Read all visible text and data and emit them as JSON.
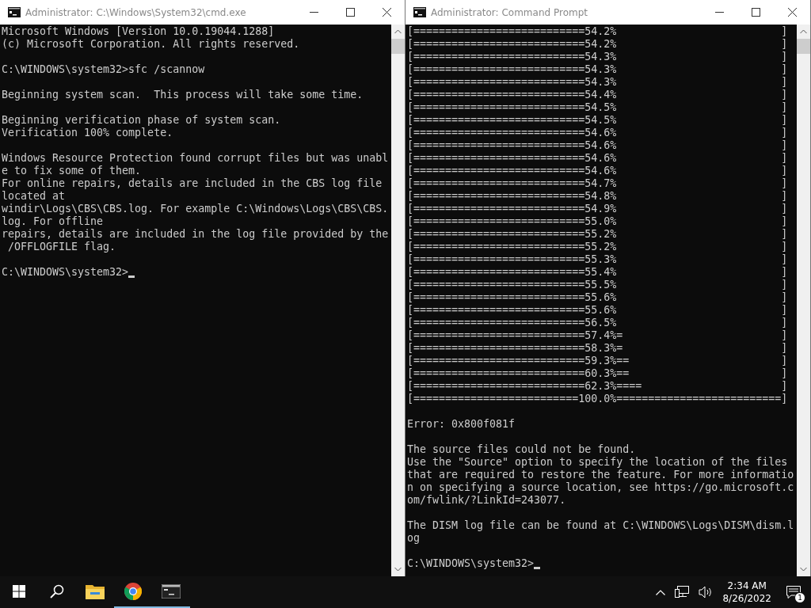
{
  "windows": [
    {
      "title": "Administrator: C:\\Windows\\System32\\cmd.exe",
      "blocks": [
        [
          "Microsoft Windows [Version 10.0.19044.1288]",
          "(c) Microsoft Corporation. All rights reserved."
        ],
        [
          "C:\\WINDOWS\\system32>sfc /scannow"
        ],
        [
          "Beginning system scan.  This process will take some time."
        ],
        [
          "Beginning verification phase of system scan.",
          "Verification 100% complete."
        ],
        [
          "Windows Resource Protection found corrupt files but was unabl",
          "e to fix some of them.",
          "For online repairs, details are included in the CBS log file",
          "located at",
          "windir\\Logs\\CBS\\CBS.log. For example C:\\Windows\\Logs\\CBS\\CBS.",
          "log. For offline",
          "repairs, details are included in the log file provided by the",
          " /OFFLOGFILE flag."
        ]
      ],
      "prompt": "C:\\WINDOWS\\system32>"
    },
    {
      "title": "Administrator: Command Prompt",
      "blocks": [
        [
          "[===========================54.2%                          ]",
          "[===========================54.2%                          ]",
          "[===========================54.3%                          ]",
          "[===========================54.3%                          ]",
          "[===========================54.3%                          ]",
          "[===========================54.4%                          ]",
          "[===========================54.5%                          ]",
          "[===========================54.5%                          ]",
          "[===========================54.6%                          ]",
          "[===========================54.6%                          ]",
          "[===========================54.6%                          ]",
          "[===========================54.6%                          ]",
          "[===========================54.7%                          ]",
          "[===========================54.8%                          ]",
          "[===========================54.9%                          ]",
          "[===========================55.0%                          ]",
          "[===========================55.2%                          ]",
          "[===========================55.2%                          ]",
          "[===========================55.3%                          ]",
          "[===========================55.4%                          ]",
          "[===========================55.5%                          ]",
          "[===========================55.6%                          ]",
          "[===========================55.6%                          ]",
          "[===========================56.5%                          ]",
          "[===========================57.4%=                         ]",
          "[===========================58.3%=                         ]",
          "[===========================59.3%==                        ]",
          "[===========================60.3%==                        ]",
          "[===========================62.3%====                      ]",
          "[==========================100.0%==========================]"
        ],
        [
          "Error: 0x800f081f"
        ],
        [
          "The source files could not be found.",
          "Use the \"Source\" option to specify the location of the files",
          "that are required to restore the feature. For more informatio",
          "n on specifying a source location, see https://go.microsoft.c",
          "om/fwlink/?LinkId=243077."
        ],
        [
          "The DISM log file can be found at C:\\WINDOWS\\Logs\\DISM\\dism.l",
          "og"
        ]
      ],
      "prompt": "C:\\WINDOWS\\system32>"
    }
  ],
  "taskbar": {
    "apps": [
      {
        "kind": "start",
        "running": false
      },
      {
        "kind": "search",
        "running": false
      },
      {
        "kind": "folder",
        "running": false
      },
      {
        "kind": "browser",
        "running": true
      },
      {
        "kind": "console",
        "running": true
      }
    ],
    "clock": {
      "time": "2:34 AM",
      "date": "8/26/2022"
    },
    "notifications": {
      "count": "1"
    }
  }
}
